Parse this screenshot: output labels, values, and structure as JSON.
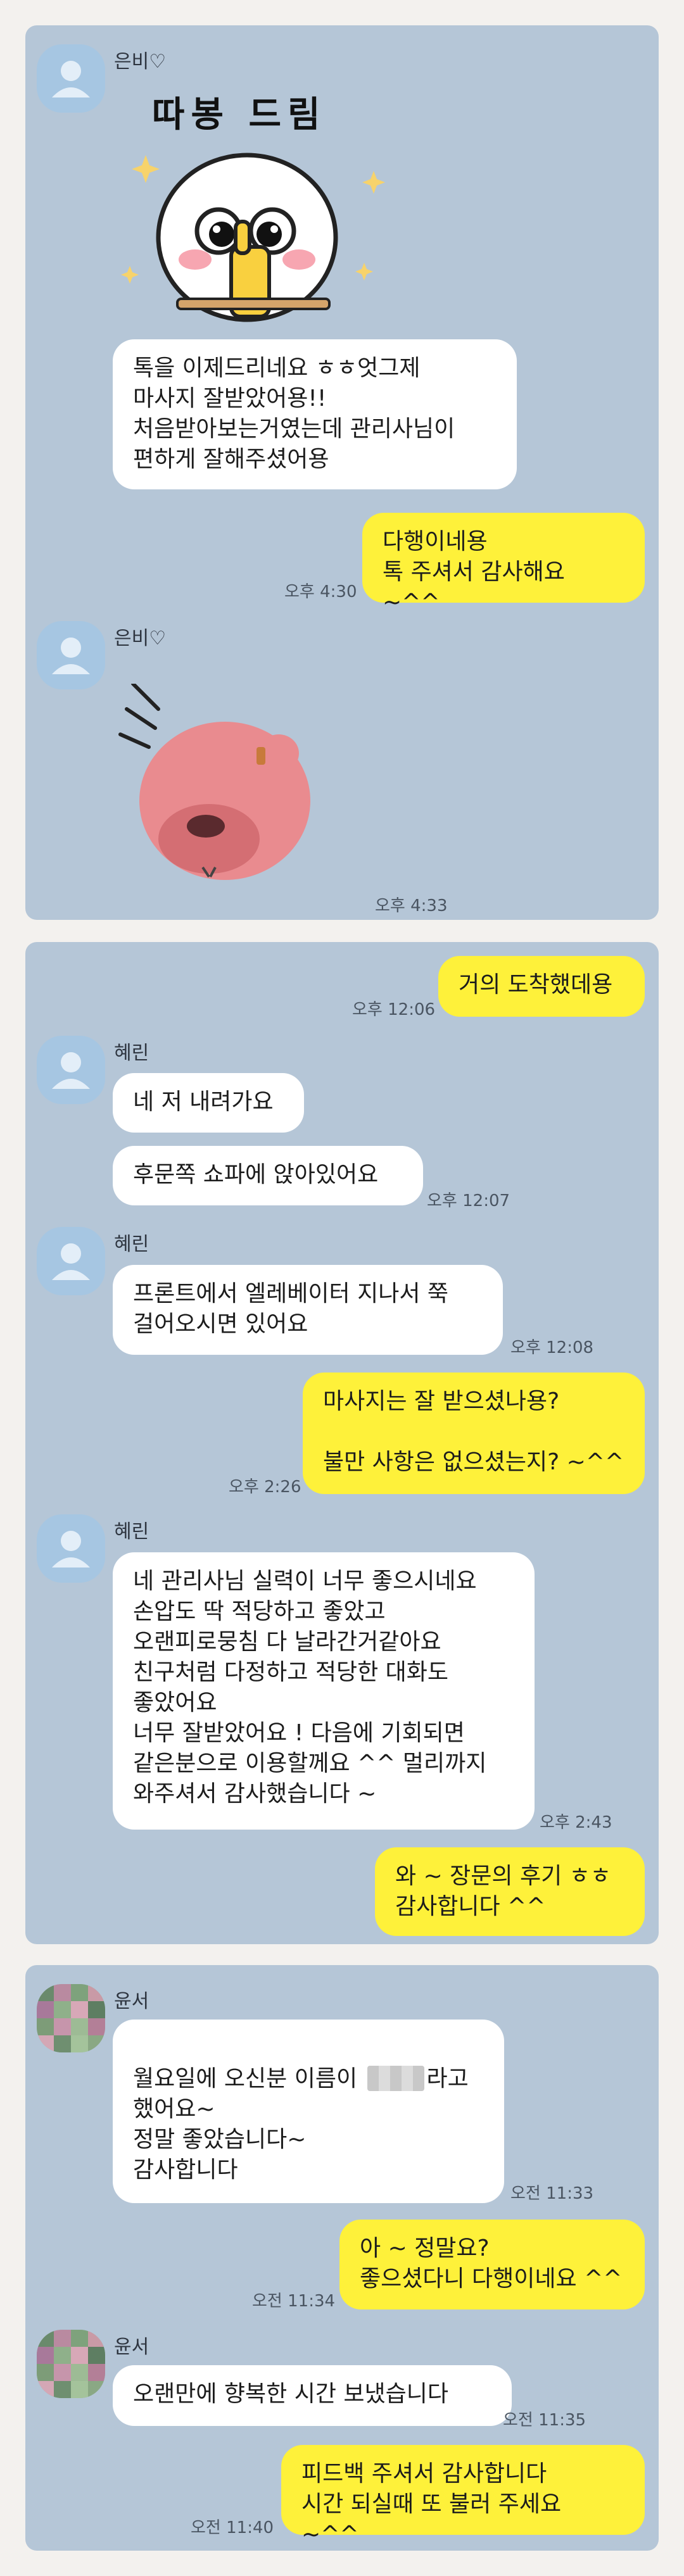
{
  "chat1": {
    "sender": "은비♡",
    "sticker_caption": "따봉 드림",
    "msg1": "톡을 이제드리네요 ㅎㅎ엇그제\n마사지 잘받았어용!!\n처음받아보는거였는데 관리사님이\n편하게 잘해주셨어용",
    "reply": "다행이네용\n톡 주셔서 감사해요 ~^^",
    "reply_time": "오후 4:30",
    "sender2": "은비♡",
    "sticker2_time": "오후 4:33"
  },
  "chat2": {
    "out1": "거의 도착했데용",
    "out1_time": "오후 12:06",
    "sender": "혜린",
    "in1": "네 저 내려가요",
    "in2": "후문쪽 쇼파에 앉아있어요",
    "in2_time": "오후 12:07",
    "sender2": "혜린",
    "in3": "프론트에서 엘레베이터 지나서 쭉\n걸어오시면 있어요",
    "in3_time": "오후 12:08",
    "out2": "마사지는 잘 받으셨나용?\n\n불만 사항은 없으셨는지? ~^^",
    "out2_time": "오후 2:26",
    "sender3": "혜린",
    "in4": "네 관리사님 실력이 너무 좋으시네요\n손압도 딱 적당하고 좋았고\n오랜피로뭉침 다 날라간거같아요\n친구처럼 다정하고 적당한 대화도\n좋았어요\n너무 잘받았어요 ! 다음에 기회되면\n같은분으로 이용할께요 ^^ 멀리까지\n와주셔서 감사했습니다 ~",
    "in4_time": "오후 2:43",
    "out3": "와 ~ 장문의 후기 ㅎㅎ\n감사합니다 ^^"
  },
  "chat3": {
    "sender": "윤서",
    "in1_pre": "월요일에 오신분 이름이 ",
    "in1_post": "라고\n했어요~\n정말 좋았습니다~\n감사합니다",
    "in1_time": "오전 11:33",
    "out1": "아 ~ 정말요?\n좋으셨다니 다행이네요 ^^",
    "out1_time": "오전 11:34",
    "sender2": "윤서",
    "in2": "오랜만에 향복한 시간 보냈습니다",
    "in2_time": "오전 11:35",
    "out2": "피드백 주셔서 감사합니다\n시간 되실때 또 불러 주세요 ~^^",
    "out2_time": "오전 11:40"
  },
  "colors": {
    "chat_bg": "#b5c6d7",
    "incoming_bubble": "#ffffff",
    "outgoing_bubble": "#fef13a",
    "page_bg": "#f3f1ee"
  },
  "icons": [
    "default-profile-icon",
    "pixelated-profile-icon",
    "thumbs-up-sticker",
    "pink-beaver-sticker"
  ]
}
